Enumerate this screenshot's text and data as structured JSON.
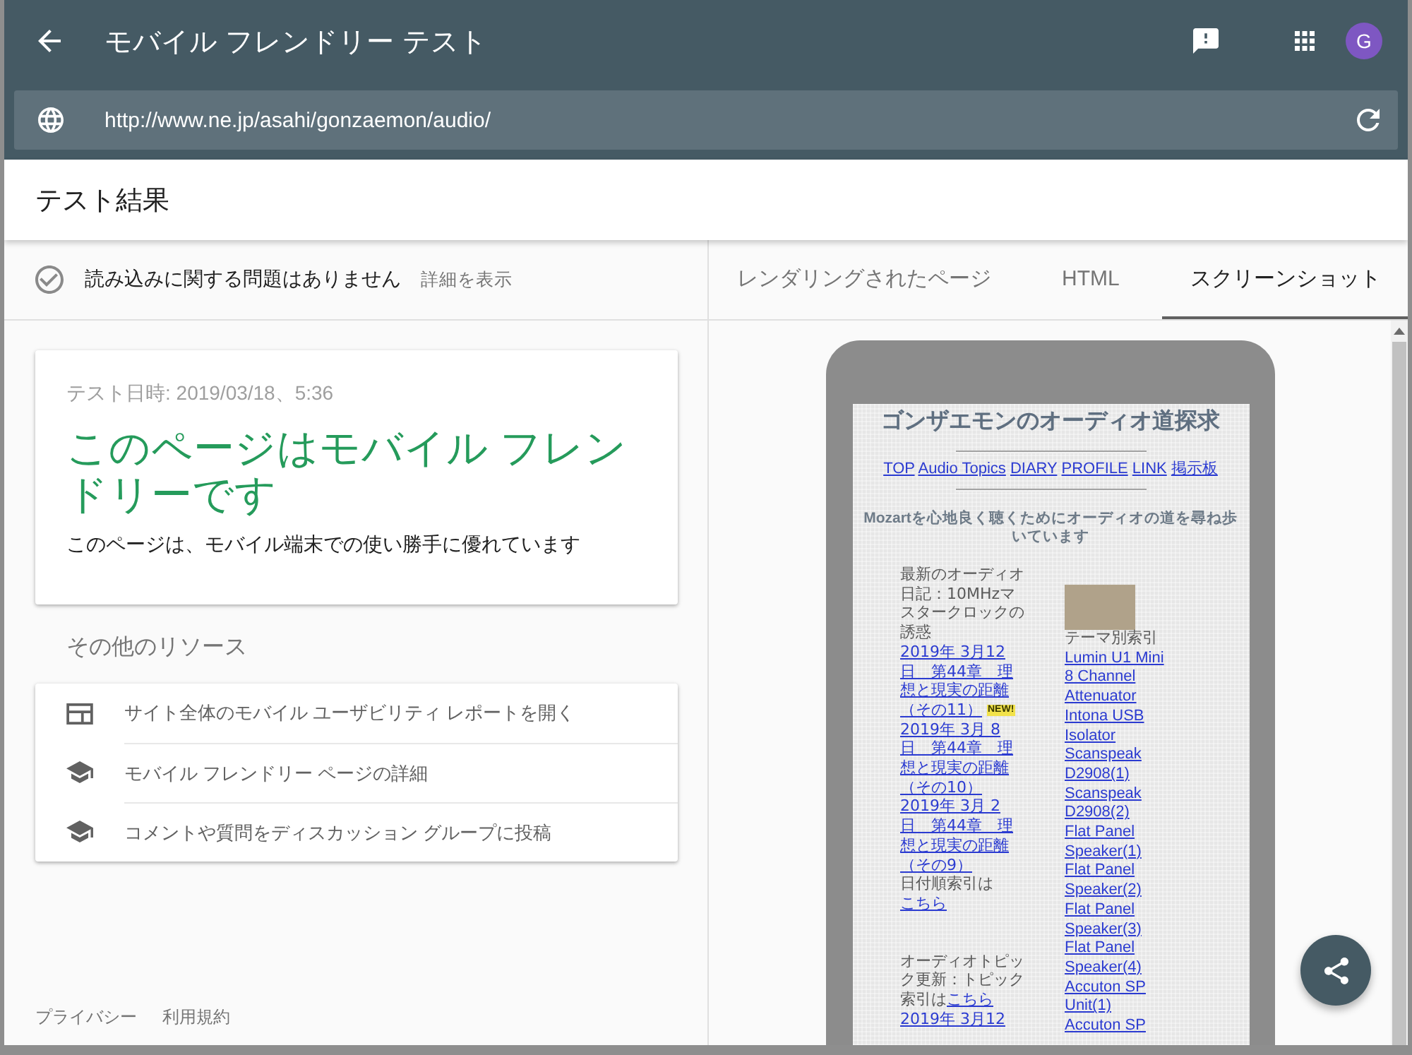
{
  "app_bar": {
    "title": "モバイル フレンドリー テスト",
    "avatar_letter": "G"
  },
  "url_bar": {
    "value": "http://www.ne.jp/asahi/gonzaemon/audio/"
  },
  "results_header": {
    "title": "テスト結果"
  },
  "load_status": {
    "message": "読み込みに関する問題はありません",
    "details_link": "詳細を表示"
  },
  "result_card": {
    "tested_at": "テスト日時: 2019/03/18、5:36",
    "verdict": "このページはモバイル フレンドリーです",
    "description": "このページは、モバイル端末での使い勝手に優れています"
  },
  "resources": {
    "heading": "その他のリソース",
    "items": [
      {
        "kind": "report",
        "label": "サイト全体のモバイル ユーザビリティ レポートを開く"
      },
      {
        "kind": "guide",
        "label": "モバイル フレンドリー ページの詳細"
      },
      {
        "kind": "guide",
        "label": "コメントや質問をディスカッション グループに投稿"
      }
    ]
  },
  "footer_links": [
    "プライバシー",
    "利用規約"
  ],
  "tabs": [
    {
      "label": "レンダリングされたページ",
      "selected": false
    },
    {
      "label": "HTML",
      "selected": false
    },
    {
      "label": "スクリーンショット",
      "selected": true
    }
  ],
  "screenshot": {
    "site_title": "ゴンザエモンのオーディオ道探求",
    "nav_links": [
      "TOP",
      "Audio Topics",
      "DIARY",
      "PROFILE",
      "LINK",
      "掲示板"
    ],
    "tagline": "Mozartを心地良く聴くためにオーディオの道を尋ね歩いています",
    "left_column": [
      {
        "entries": [
          {
            "kind": "text",
            "text": "最新のオーディオ日記：10MHzマスタークロックの誘惑"
          },
          {
            "kind": "link",
            "text": "2019年 3月12日　第44章　理想と現実の距離（その11）",
            "badge": "NEW!"
          },
          {
            "kind": "link",
            "text": "2019年 3月 8日　第44章　理想と現実の距離（その10）"
          },
          {
            "kind": "link",
            "text": "2019年 3月 2日　第44章　理想と現実の距離（その9）"
          },
          {
            "kind": "text_link",
            "text": "日付順索引は",
            "link": "こちら"
          }
        ]
      },
      {
        "entries": [
          {
            "kind": "text_link",
            "text": "オーディオトピック更新：トピック索引は",
            "link": "こちら"
          },
          {
            "kind": "link",
            "text": "2019年 3月12"
          }
        ]
      }
    ],
    "right_column": {
      "heading": "テーマ別索引",
      "links": [
        "Lumin U1 Mini",
        "8 Channel Attenuator",
        "Intona USB Isolator",
        "Scanspeak D2908(1)",
        "Scanspeak D2908(2)",
        "Flat Panel Speaker(1)",
        "Flat Panel Speaker(2)",
        "Flat Panel Speaker(3)",
        "Flat Panel Speaker(4)",
        "Accuton SP Unit(1)",
        "Accuton SP"
      ]
    }
  }
}
